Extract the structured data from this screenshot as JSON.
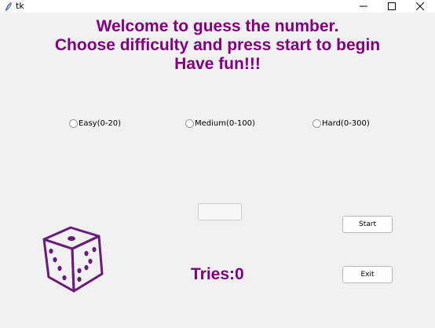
{
  "window": {
    "title": "tk"
  },
  "welcome": {
    "line1": "Welcome to guess the number.",
    "line2": "Choose difficulty and press start to begin",
    "line3": "Have fun!!!"
  },
  "difficulty": {
    "options": [
      {
        "label": "Easy(0-20)",
        "selected": false
      },
      {
        "label": "Medium(0-100)",
        "selected": false
      },
      {
        "label": "Hard(0-300)",
        "selected": false
      }
    ]
  },
  "guess_input": {
    "value": ""
  },
  "buttons": {
    "start_label": "Start",
    "exit_label": "Exit"
  },
  "tries": {
    "label": "Tries:",
    "value": "0"
  },
  "colors": {
    "accent": "#800080",
    "background": "#f0f0f0"
  },
  "icons": {
    "app": "feather-icon",
    "dice": "dice-icon"
  }
}
